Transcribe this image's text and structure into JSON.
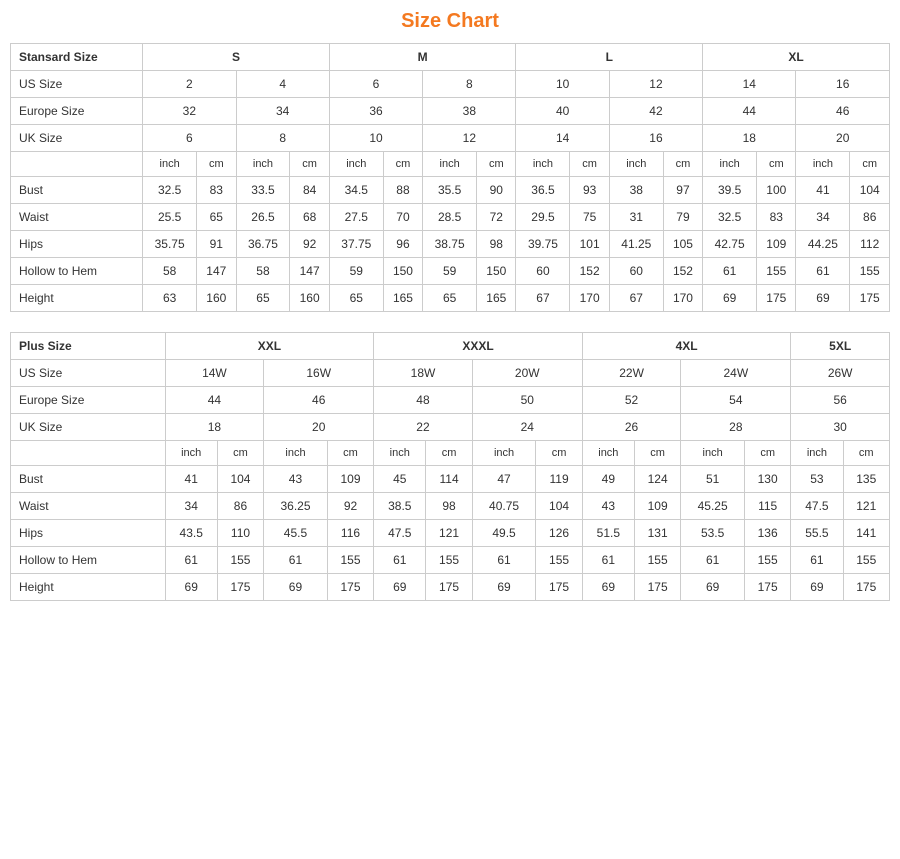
{
  "title": "Size Chart",
  "standard": {
    "headers": [
      {
        "label": "Stansard Size",
        "colspan": 1
      },
      {
        "label": "S",
        "colspan": 4
      },
      {
        "label": "M",
        "colspan": 4
      },
      {
        "label": "L",
        "colspan": 4
      },
      {
        "label": "XL",
        "colspan": 4
      }
    ],
    "us_size": {
      "label": "US Size",
      "values": [
        "2",
        "4",
        "6",
        "8",
        "10",
        "12",
        "14",
        "16"
      ]
    },
    "europe_size": {
      "label": "Europe Size",
      "values": [
        "32",
        "34",
        "36",
        "38",
        "40",
        "42",
        "44",
        "46"
      ]
    },
    "uk_size": {
      "label": "UK Size",
      "values": [
        "6",
        "8",
        "10",
        "12",
        "14",
        "16",
        "18",
        "20"
      ]
    },
    "units": [
      "inch",
      "cm",
      "inch",
      "cm",
      "inch",
      "cm",
      "inch",
      "cm",
      "inch",
      "cm",
      "inch",
      "cm",
      "inch",
      "cm",
      "inch",
      "cm"
    ],
    "bust": {
      "label": "Bust",
      "values": [
        "32.5",
        "83",
        "33.5",
        "84",
        "34.5",
        "88",
        "35.5",
        "90",
        "36.5",
        "93",
        "38",
        "97",
        "39.5",
        "100",
        "41",
        "104"
      ]
    },
    "waist": {
      "label": "Waist",
      "values": [
        "25.5",
        "65",
        "26.5",
        "68",
        "27.5",
        "70",
        "28.5",
        "72",
        "29.5",
        "75",
        "31",
        "79",
        "32.5",
        "83",
        "34",
        "86"
      ]
    },
    "hips": {
      "label": "Hips",
      "values": [
        "35.75",
        "91",
        "36.75",
        "92",
        "37.75",
        "96",
        "38.75",
        "98",
        "39.75",
        "101",
        "41.25",
        "105",
        "42.75",
        "109",
        "44.25",
        "112"
      ]
    },
    "hollow_to_hem": {
      "label": "Hollow to Hem",
      "values": [
        "58",
        "147",
        "58",
        "147",
        "59",
        "150",
        "59",
        "150",
        "60",
        "152",
        "60",
        "152",
        "61",
        "155",
        "61",
        "155"
      ]
    },
    "height": {
      "label": "Height",
      "values": [
        "63",
        "160",
        "65",
        "160",
        "65",
        "165",
        "65",
        "165",
        "67",
        "170",
        "67",
        "170",
        "69",
        "175",
        "69",
        "175"
      ]
    }
  },
  "plus": {
    "headers": [
      {
        "label": "Plus Size",
        "colspan": 1
      },
      {
        "label": "XXL",
        "colspan": 4
      },
      {
        "label": "XXXL",
        "colspan": 4
      },
      {
        "label": "4XL",
        "colspan": 4
      },
      {
        "label": "5XL",
        "colspan": 2
      }
    ],
    "us_size": {
      "label": "US Size",
      "values": [
        "14W",
        "16W",
        "18W",
        "20W",
        "22W",
        "24W",
        "26W"
      ]
    },
    "europe_size": {
      "label": "Europe Size",
      "values": [
        "44",
        "46",
        "48",
        "50",
        "52",
        "54",
        "56"
      ]
    },
    "uk_size": {
      "label": "UK Size",
      "values": [
        "18",
        "20",
        "22",
        "24",
        "26",
        "28",
        "30"
      ]
    },
    "units": [
      "inch",
      "cm",
      "inch",
      "cm",
      "inch",
      "cm",
      "inch",
      "cm",
      "inch",
      "cm",
      "inch",
      "cm",
      "inch",
      "cm"
    ],
    "bust": {
      "label": "Bust",
      "values": [
        "41",
        "104",
        "43",
        "109",
        "45",
        "114",
        "47",
        "119",
        "49",
        "124",
        "51",
        "130",
        "53",
        "135"
      ]
    },
    "waist": {
      "label": "Waist",
      "values": [
        "34",
        "86",
        "36.25",
        "92",
        "38.5",
        "98",
        "40.75",
        "104",
        "43",
        "109",
        "45.25",
        "115",
        "47.5",
        "121"
      ]
    },
    "hips": {
      "label": "Hips",
      "values": [
        "43.5",
        "110",
        "45.5",
        "116",
        "47.5",
        "121",
        "49.5",
        "126",
        "51.5",
        "131",
        "53.5",
        "136",
        "55.5",
        "141"
      ]
    },
    "hollow_to_hem": {
      "label": "Hollow to Hem",
      "values": [
        "61",
        "155",
        "61",
        "155",
        "61",
        "155",
        "61",
        "155",
        "61",
        "155",
        "61",
        "155",
        "61",
        "155"
      ]
    },
    "height": {
      "label": "Height",
      "values": [
        "69",
        "175",
        "69",
        "175",
        "69",
        "175",
        "69",
        "175",
        "69",
        "175",
        "69",
        "175",
        "69",
        "175"
      ]
    }
  }
}
